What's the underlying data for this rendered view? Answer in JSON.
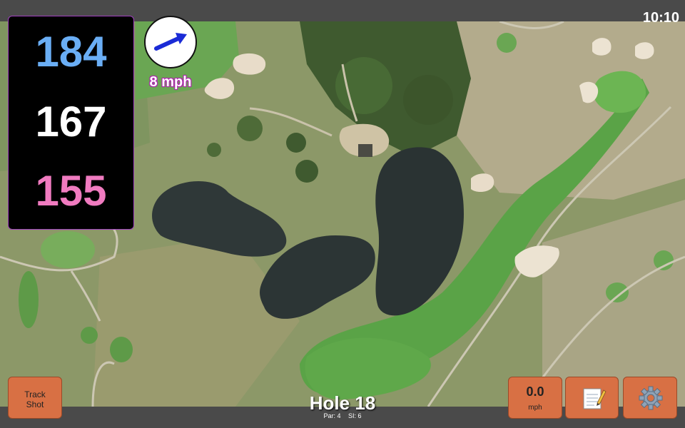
{
  "status": {
    "time": "10:10"
  },
  "distances": {
    "back": "184",
    "middle": "167",
    "front": "155"
  },
  "wind": {
    "speed": "8 mph",
    "direction_icon": "wind-arrow-icon"
  },
  "hole": {
    "title": "Hole 18",
    "par": "Par: 4",
    "si": "SI: 6"
  },
  "buttons": {
    "track_shot": "Track Shot",
    "swing_speed_value": "0.0",
    "swing_speed_unit": "mph",
    "notes_icon": "notepad-icon",
    "settings_icon": "gear-icon"
  },
  "colors": {
    "back_distance": "#6aaef5",
    "middle_distance": "#ffffff",
    "front_distance": "#f07bc0",
    "button_bg": "#d87044",
    "wind_arrow": "#1a2bd6"
  }
}
